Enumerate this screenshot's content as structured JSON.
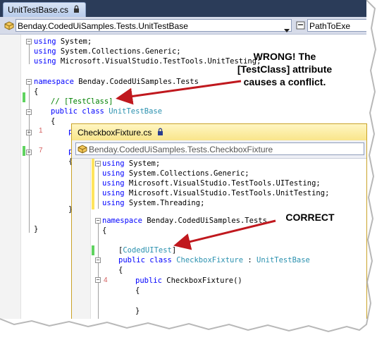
{
  "editor1": {
    "tab_title": "UnitTestBase.cs",
    "type_combo": "Benday.CodedUiSamples.Tests.UnitTestBase",
    "member_combo": "PathToExe",
    "lines": {
      "l1_kw": "using",
      "l1_rest": " System;",
      "l2_kw": "using",
      "l2_rest": " System.Collections.Generic;",
      "l3_kw": "using",
      "l3_rest": " Microsoft.VisualStudio.TestTools.UnitTesting;",
      "l5_kw": "namespace",
      "l5_rest": " Benday.CodedUiSamples.Tests",
      "l6": "{",
      "l7_comment": "// [TestClass]",
      "l8_kw1": "public",
      "l8_kw2": " class ",
      "l8_type": "UnitTestBase",
      "l9": "{",
      "l10_p": "p",
      "l12_p": "p",
      "l13": "{",
      "l_close1": "}",
      "l_close2": "}"
    },
    "collapsed_counts": {
      "a": "1",
      "b": "7"
    }
  },
  "editor2": {
    "tab_title": "CheckboxFixture.cs",
    "type_combo": "Benday.CodedUiSamples.Tests.CheckboxFixture",
    "lines": {
      "l1_kw": "using",
      "l1_rest": " System;",
      "l2_kw": "using",
      "l2_rest": " System.Collections.Generic;",
      "l3_kw": "using",
      "l3_rest": " Microsoft.VisualStudio.TestTools.UITesting;",
      "l4_kw": "using",
      "l4_rest": " Microsoft.VisualStudio.TestTools.UnitTesting;",
      "l5_kw": "using",
      "l5_rest": " System.Threading;",
      "l7_kw": "namespace",
      "l7_rest": " Benday.CodedUiSamples.Tests",
      "l8": "{",
      "l10_b1": "[",
      "l10_attr": "CodedUITest",
      "l10_b2": "]",
      "l11_kw1": "public",
      "l11_kw2": " class ",
      "l11_type": "CheckboxFixture",
      "l11_mid": " : ",
      "l11_base": "UnitTestBase",
      "l12": "{",
      "l13_kw": "public",
      "l13_rest": " CheckboxFixture()",
      "l14": "{",
      "l16": "}"
    },
    "collapsed_count": "4"
  },
  "annotations": {
    "wrong": [
      "WRONG!  The",
      "[TestClass] attribute",
      "causes a conflict."
    ],
    "correct": "CORRECT"
  },
  "colors": {
    "keyword": "#0000ff",
    "type": "#2b91af",
    "comment": "#008000",
    "arrow": "#c0181e"
  }
}
